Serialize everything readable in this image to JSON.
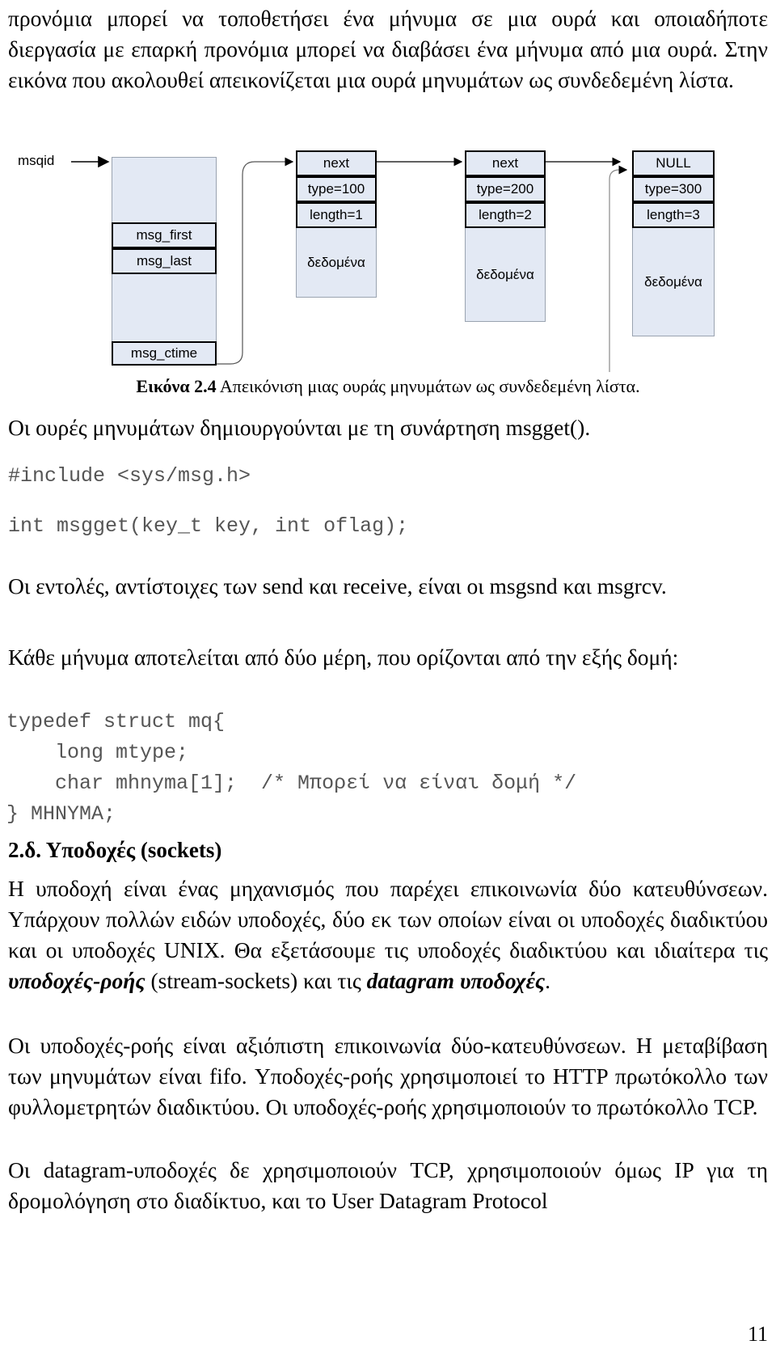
{
  "document": {
    "page_number": "11"
  },
  "paragraphs": {
    "intro": "προνόμια μπορεί να τοποθετήσει ένα μήνυμα σε μια ουρά και οποιαδήποτε διεργασία με επαρκή προνόμια μπορεί να διαβάσει ένα μήνυμα από μια ουρά. Στην εικόνα που ακολουθεί απεικονίζεται μια ουρά μηνυμάτων ως συνδεδεμένη λίστα.",
    "msgget_intro": "Οι ουρές μηνυμάτων δημιουργούνται με τη συνάρτηση msgget().",
    "send_receive": "Οι εντολές, αντίστοιχες των send και receive, είναι οι msgsnd και msgrcv.",
    "message_parts": "Κάθε μήνυμα αποτελείται από δύο μέρη, που ορίζονται από την εξής δομή:",
    "sockets_intro_1": "Η υποδοχή είναι ένας μηχανισμός που παρέχει επικοινωνία δύο κατευθύνσεων. Υπάρχουν πολλών ειδών υποδοχές, δύο εκ των οποίων είναι οι υποδοχές διαδικτύου και οι υποδοχές UNIX. Θα εξετάσουμε τις υποδοχές διαδικτύου και ιδιαίτερα τις ",
    "sockets_bold_1": "υποδοχές-ροής",
    "sockets_intro_2": " (stream-sockets) και τις ",
    "sockets_bold_2": "datagram υποδοχές",
    "sockets_intro_3": ".",
    "stream_sockets": "Οι υποδοχές-ροής είναι αξιόπιστη επικοινωνία δύο-κατευθύνσεων. Η μεταβίβαση των μηνυμάτων είναι fifo. Υποδοχές-ροής χρησιμοποιεί το HTTP πρωτόκολλο των φυλλομετρητών διαδικτύου. Οι υποδοχές-ροής χρησιμοποιούν το πρωτόκολλο TCP.",
    "datagram_sockets": "Οι datagram-υποδοχές δε χρησιμοποιούν TCP, χρησιμοποιούν όμως IP για τη δρομολόγηση στο διαδίκτυο, και το User Datagram Protocol"
  },
  "figure": {
    "caption_label": "Εικόνα 2.4",
    "caption_text": " Απεικόνιση μιας ουράς μηνυμάτων ως συνδεδεμένη λίστα.",
    "msqid_label": "msqid",
    "queue_struct": {
      "msg_first": "msg_first",
      "msg_last": "msg_last",
      "msg_ctime": "msg_ctime"
    },
    "nodes": [
      {
        "next": "next",
        "type": "type=100",
        "length": "length=1",
        "data": "δεδομένα"
      },
      {
        "next": "next",
        "type": "type=200",
        "length": "length=2",
        "data": "δεδομένα"
      },
      {
        "next": "NULL",
        "type": "type=300",
        "length": "length=3",
        "data": "δεδομένα"
      }
    ],
    "colors": {
      "box_fill": "#e3e9f4",
      "box_border": "#9aa3b0",
      "cell_border": "#000000"
    }
  },
  "code": {
    "include_line": "#include <sys/msg.h>",
    "msgget_line": "int msgget(key_t key, int oflag);",
    "struct_block": "typedef struct mq{\n    long mtype;\n    char mhnyma[1];  /* Μπορεί να είναι δομή */\n} MHNYMA;"
  },
  "headings": {
    "sockets": "2.δ. Υποδοχές (sockets)"
  }
}
